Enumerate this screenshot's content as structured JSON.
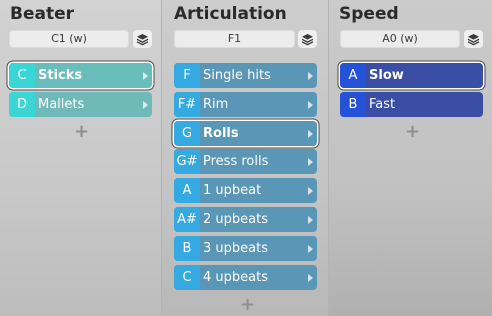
{
  "beater": {
    "title": "Beater",
    "select_value": "C1 (w)",
    "items": [
      {
        "key": "C",
        "label": "Sticks",
        "selected": true
      },
      {
        "key": "D",
        "label": "Mallets",
        "selected": false
      }
    ]
  },
  "articulation": {
    "title": "Articulation",
    "select_value": "F1",
    "items": [
      {
        "key": "F",
        "label": "Single hits",
        "selected": false
      },
      {
        "key": "F#",
        "label": "Rim",
        "selected": false
      },
      {
        "key": "G",
        "label": "Rolls",
        "selected": true
      },
      {
        "key": "G#",
        "label": "Press rolls",
        "selected": false
      },
      {
        "key": "A",
        "label": "1 upbeat",
        "selected": false
      },
      {
        "key": "A#",
        "label": "2 upbeats",
        "selected": false
      },
      {
        "key": "B",
        "label": "3 upbeats",
        "selected": false
      },
      {
        "key": "C",
        "label": "4 upbeats",
        "selected": false
      }
    ]
  },
  "speed": {
    "title": "Speed",
    "select_value": "A0 (w)",
    "items": [
      {
        "key": "A",
        "label": "Slow",
        "selected": true
      },
      {
        "key": "B",
        "label": "Fast",
        "selected": false
      }
    ]
  },
  "icons": {
    "layers": "layers-icon",
    "add": "plus-icon",
    "submenu": "chevron-right-icon"
  },
  "add_symbol": "+",
  "colors": {
    "beater_key": "#3ad6d6",
    "beater_row": "#6fb9b8",
    "articulation_key": "#35a9e2",
    "articulation_row": "#5a97b6",
    "speed_key": "#2452d8",
    "speed_row": "#3a4ea6"
  }
}
